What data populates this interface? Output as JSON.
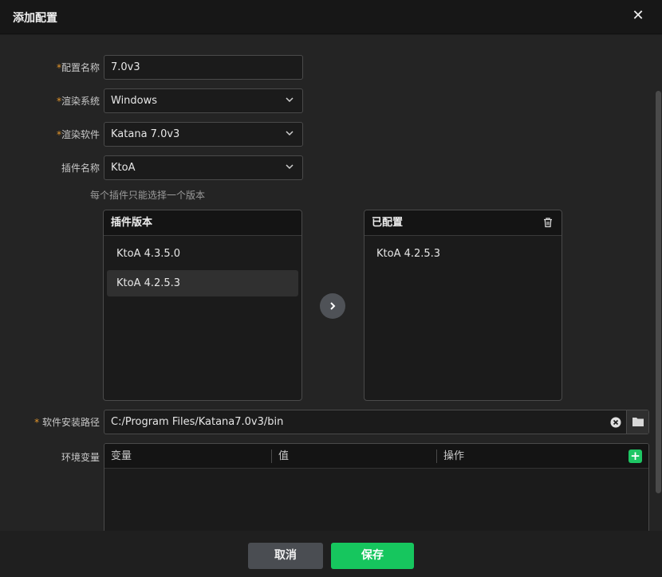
{
  "dialog": {
    "title": "添加配置",
    "close_icon": "close-icon"
  },
  "form": {
    "config_name": {
      "label": "配置名称",
      "required": true,
      "value": "7.0v3"
    },
    "render_system": {
      "label": "渲染系统",
      "required": true,
      "value": "Windows"
    },
    "render_software": {
      "label": "渲染软件",
      "required": true,
      "value": "Katana 7.0v3"
    },
    "plugin_name": {
      "label": "插件名称",
      "required": false,
      "value": "KtoA"
    },
    "plugin_hint": "每个插件只能选择一个版本",
    "install_path": {
      "label": "软件安装路径",
      "required": true,
      "value": "C:/Program Files/Katana7.0v3/bin"
    },
    "env_vars": {
      "label": "环境变量",
      "columns": [
        "变量",
        "值",
        "操作"
      ],
      "rows": []
    }
  },
  "plugin_versions": {
    "title": "插件版本",
    "items": [
      "KtoA 4.3.5.0",
      "KtoA 4.2.5.3"
    ],
    "selected_index": 1
  },
  "configured": {
    "title": "已配置",
    "items": [
      "KtoA 4.2.5.3"
    ]
  },
  "footer": {
    "cancel_label": "取消",
    "save_label": "保存"
  },
  "colors": {
    "accent_green": "#16c65e",
    "required_marker": "#e3962b",
    "background": "#242424"
  }
}
